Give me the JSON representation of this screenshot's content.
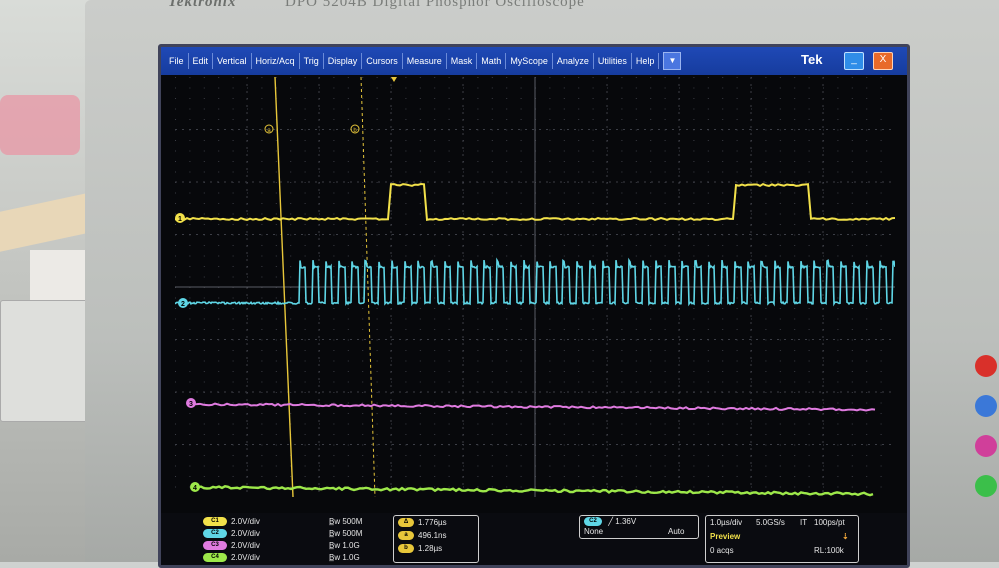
{
  "instrument": {
    "brand": "Tektronix",
    "model": "DPO 5204B Digital Phosphor Oscilloscope"
  },
  "menubar": {
    "items": [
      "File",
      "Edit",
      "Vertical",
      "Horiz/Acq",
      "Trig",
      "Display",
      "Cursors",
      "Measure",
      "Mask",
      "Math",
      "MyScope",
      "Analyze",
      "Utilities",
      "Help"
    ],
    "dropdown_glyph": "▼",
    "logo": "Tek",
    "minimize_glyph": "_",
    "close_glyph": "X"
  },
  "graticule": {
    "cursor_a_label": "a",
    "cursor_b_label": "b",
    "channel_markers": [
      "1",
      "2",
      "3",
      "4"
    ],
    "trigger_glyph": "▼"
  },
  "channels": [
    {
      "chip": "C1",
      "scale": "2.0V/div",
      "bw": "500M",
      "color": "#f2e14a"
    },
    {
      "chip": "C2",
      "scale": "2.0V/div",
      "bw": "500M",
      "color": "#5fd6e6"
    },
    {
      "chip": "C3",
      "scale": "2.0V/div",
      "bw": "1.0G",
      "color": "#e07be0"
    },
    {
      "chip": "C4",
      "scale": "2.0V/div",
      "bw": "1.0G",
      "color": "#9de84a"
    }
  ],
  "cursor_readout": {
    "delta_t": "1.776µs",
    "t2": "496.1ns",
    "t3": "1.28µs"
  },
  "trigger": {
    "chip": "C2",
    "level": "1.36V",
    "coupling": "None",
    "mode": "Auto"
  },
  "acquisition": {
    "horiz_scale": "1.0µs/div",
    "sample_rate": "5.0GS/s",
    "it": "IT",
    "resolution": "100ps/pt",
    "state": "Preview",
    "acqs": "0 acqs",
    "record_length": "RL:100k"
  },
  "colors": {
    "menubar": "#1f49b6",
    "ch1": "#f2e14a",
    "ch2": "#5fd6e6",
    "ch3": "#e07be0",
    "ch4": "#9de84a",
    "cursor": "#e8c73a"
  }
}
